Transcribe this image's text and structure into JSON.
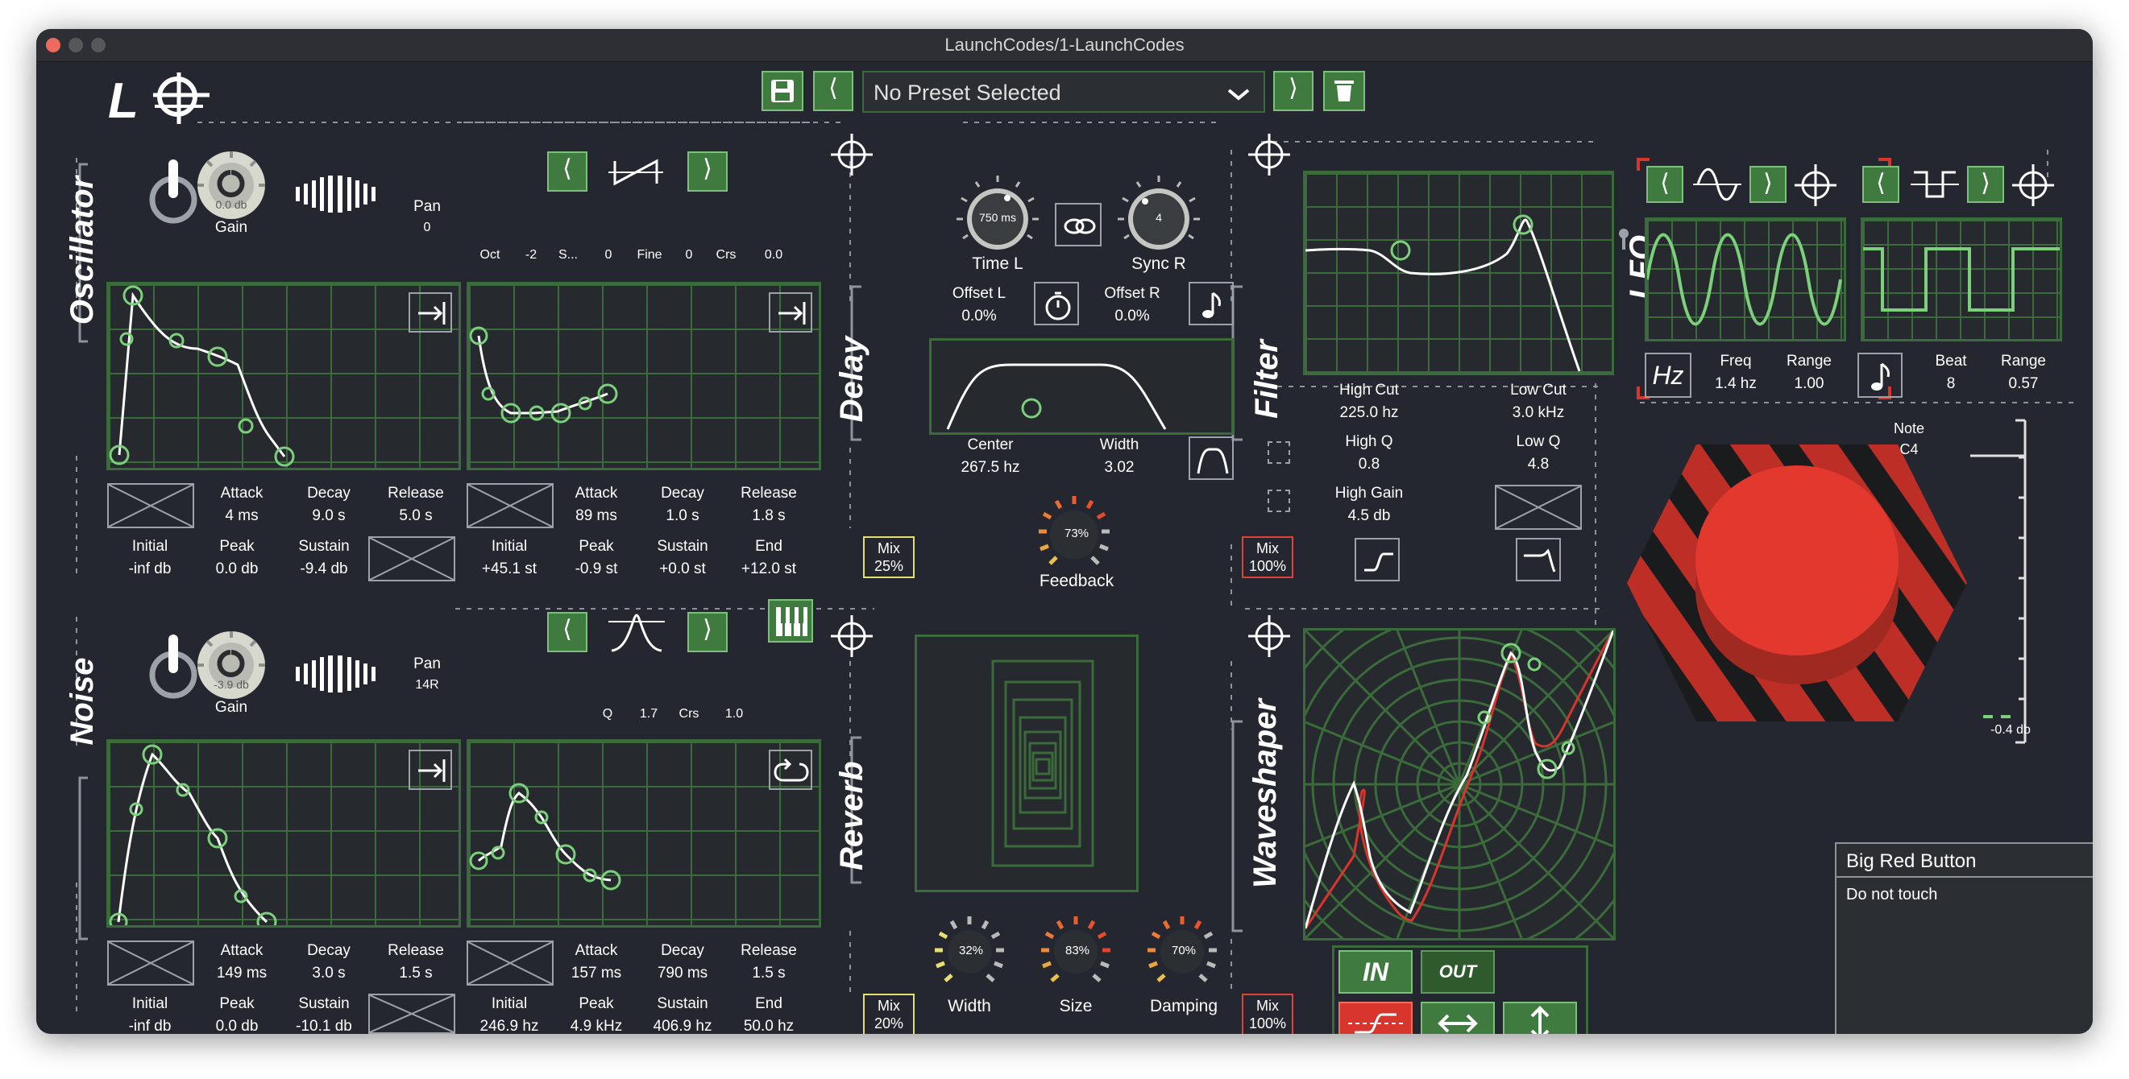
{
  "window": {
    "title": "LaunchCodes/1-LaunchCodes"
  },
  "header": {
    "logo": "LC",
    "preset": "No Preset Selected"
  },
  "oscillator": {
    "title": "Oscillator",
    "gain_label": "Gain",
    "gain_value": "0.0 db",
    "pan_label": "Pan",
    "pan_value": "0",
    "oct_label": "Oct",
    "oct_value": "-2",
    "s_label": "S...",
    "s_value": "0",
    "fine_label": "Fine",
    "fine_value": "0",
    "crs_label": "Crs",
    "crs_value": "0.0",
    "amp_env": {
      "attack_label": "Attack",
      "attack": "4 ms",
      "decay_label": "Decay",
      "decay": "9.0 s",
      "release_label": "Release",
      "release": "5.0 s",
      "initial_label": "Initial",
      "initial": "-inf db",
      "peak_label": "Peak",
      "peak": "0.0 db",
      "sustain_label": "Sustain",
      "sustain": "-9.4 db"
    },
    "pitch_env": {
      "attack_label": "Attack",
      "attack": "89 ms",
      "decay_label": "Decay",
      "decay": "1.0 s",
      "release_label": "Release",
      "release": "1.8 s",
      "initial_label": "Initial",
      "initial": "+45.1 st",
      "peak_label": "Peak",
      "peak": "-0.9 st",
      "sustain_label": "Sustain",
      "sustain": "+0.0 st",
      "end_label": "End",
      "end": "+12.0 st"
    }
  },
  "noise": {
    "title": "Noise",
    "gain_label": "Gain",
    "gain_value": "-3.9 db",
    "pan_label": "Pan",
    "pan_value": "14R",
    "q_label": "Q",
    "q_value": "1.7",
    "crs_label": "Crs",
    "crs_value": "1.0",
    "amp_env": {
      "attack_label": "Attack",
      "attack": "149 ms",
      "decay_label": "Decay",
      "decay": "3.0 s",
      "release_label": "Release",
      "release": "1.5 s",
      "initial_label": "Initial",
      "initial": "-inf db",
      "peak_label": "Peak",
      "peak": "0.0 db",
      "sustain_label": "Sustain",
      "sustain": "-10.1 db"
    },
    "filter_env": {
      "attack_label": "Attack",
      "attack": "157 ms",
      "decay_label": "Decay",
      "decay": "790 ms",
      "release_label": "Release",
      "release": "1.5 s",
      "initial_label": "Initial",
      "initial": "246.9 hz",
      "peak_label": "Peak",
      "peak": "4.9 kHz",
      "sustain_label": "Sustain",
      "sustain": "406.9 hz",
      "end_label": "End",
      "end": "50.0 hz"
    }
  },
  "delay": {
    "title": "Delay",
    "time_knob": "750 ms",
    "time_label": "Time L",
    "sync_knob": "4",
    "sync_label": "Sync R",
    "offset_l_label": "Offset L",
    "offset_l": "0.0%",
    "offset_r_label": "Offset R",
    "offset_r": "0.0%",
    "center_label": "Center",
    "center": "267.5 hz",
    "width_label": "Width",
    "width": "3.02",
    "feedback_knob": "73%",
    "feedback_label": "Feedback",
    "mix_label": "Mix",
    "mix": "25%"
  },
  "filter": {
    "title": "Filter",
    "high_cut_label": "High Cut",
    "high_cut": "225.0 hz",
    "low_cut_label": "Low Cut",
    "low_cut": "3.0 kHz",
    "high_q_label": "High Q",
    "high_q": "0.8",
    "low_q_label": "Low Q",
    "low_q": "4.8",
    "high_gain_label": "High Gain",
    "high_gain": "4.5 db",
    "mix_label": "Mix",
    "mix": "100%"
  },
  "reverb": {
    "title": "Reverb",
    "width_knob": "32%",
    "width_label": "Width",
    "size_knob": "83%",
    "size_label": "Size",
    "damping_knob": "70%",
    "damping_label": "Damping",
    "mix_label": "Mix",
    "mix": "20%"
  },
  "waveshaper": {
    "title": "Waveshaper",
    "in_label": "IN",
    "out_label": "OUT",
    "mix_label": "Mix",
    "mix": "100%"
  },
  "lfo": {
    "title": "LFO",
    "hz_label": "Hz",
    "freq_label": "Freq",
    "freq": "1.4 hz",
    "range1_label": "Range",
    "range1": "1.00",
    "beat_label": "Beat",
    "beat": "8",
    "range2_label": "Range",
    "range2": "0.57"
  },
  "meter": {
    "note_label": "Note",
    "note": "C4",
    "level": "-0.4 db"
  },
  "tooltip": {
    "title": "Big Red Button",
    "body": "Do not touch"
  },
  "colors": {
    "background": "#242730",
    "grid": "#3b6b3b",
    "curve_point": "#7cd07c",
    "accent_red": "#e04238",
    "mix_yellow": "#e6e070",
    "button_green": "#3f7a3f"
  }
}
